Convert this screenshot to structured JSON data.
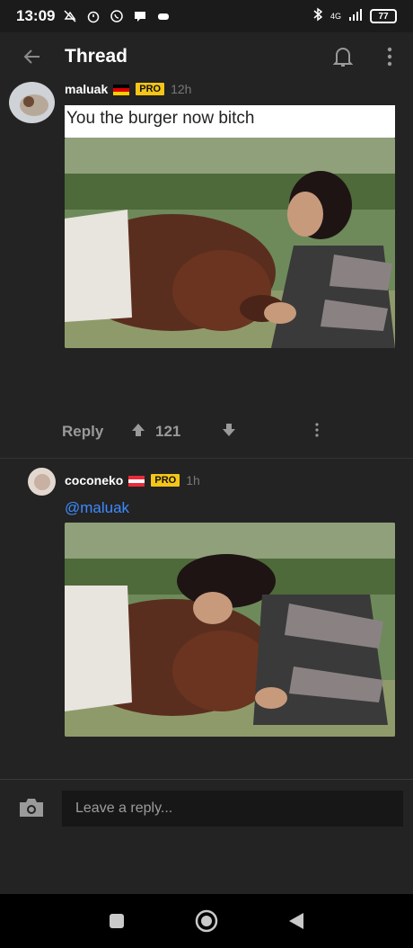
{
  "status_bar": {
    "time": "13:09",
    "network": "4G",
    "battery": "77"
  },
  "header": {
    "title": "Thread"
  },
  "comments": [
    {
      "username": "maluak",
      "badge": "PRO",
      "time": "12h",
      "caption": "You the burger now bitch",
      "reply_label": "Reply",
      "score": "121"
    },
    {
      "username": "coconeko",
      "badge": "PRO",
      "time": "1h",
      "mention": "@maluak"
    }
  ],
  "reply_box": {
    "placeholder": "Leave a reply..."
  },
  "colors": {
    "background": "#232323",
    "pro_badge": "#f5c518",
    "mention": "#3d8bff",
    "divider": "#333333"
  }
}
